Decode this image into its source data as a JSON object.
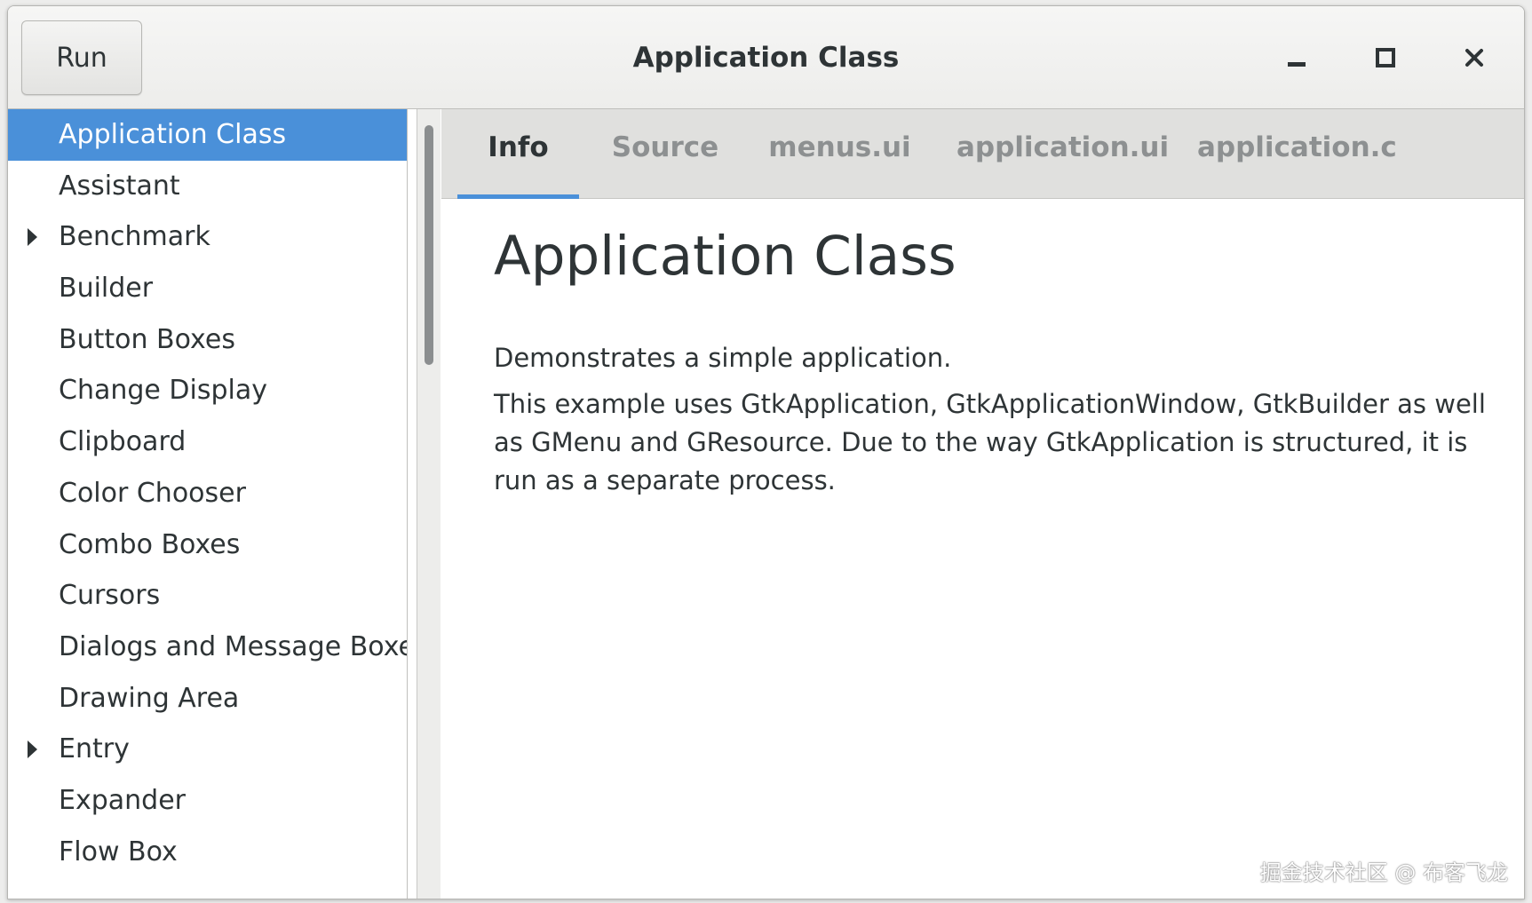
{
  "window": {
    "title": "Application Class",
    "run_label": "Run",
    "controls": {
      "minimize_icon": "minimize-icon",
      "maximize_icon": "maximize-icon",
      "close_icon": "close-icon",
      "close_glyph": "✕"
    }
  },
  "sidebar": {
    "items": [
      {
        "label": "Application Class",
        "selected": true,
        "expandable": false
      },
      {
        "label": "Assistant",
        "selected": false,
        "expandable": false
      },
      {
        "label": "Benchmark",
        "selected": false,
        "expandable": true
      },
      {
        "label": "Builder",
        "selected": false,
        "expandable": false
      },
      {
        "label": "Button Boxes",
        "selected": false,
        "expandable": false
      },
      {
        "label": "Change Display",
        "selected": false,
        "expandable": false
      },
      {
        "label": "Clipboard",
        "selected": false,
        "expandable": false
      },
      {
        "label": "Color Chooser",
        "selected": false,
        "expandable": false
      },
      {
        "label": "Combo Boxes",
        "selected": false,
        "expandable": false
      },
      {
        "label": "Cursors",
        "selected": false,
        "expandable": false
      },
      {
        "label": "Dialogs and Message Boxes",
        "selected": false,
        "expandable": false
      },
      {
        "label": "Drawing Area",
        "selected": false,
        "expandable": false
      },
      {
        "label": "Entry",
        "selected": false,
        "expandable": true
      },
      {
        "label": "Expander",
        "selected": false,
        "expandable": false
      },
      {
        "label": "Flow Box",
        "selected": false,
        "expandable": false
      }
    ]
  },
  "tabs": [
    {
      "label": "Info",
      "active": true
    },
    {
      "label": "Source",
      "active": false
    },
    {
      "label": "menus.ui",
      "active": false
    },
    {
      "label": "application.ui",
      "active": false
    },
    {
      "label": "application.c",
      "active": false
    }
  ],
  "content": {
    "heading": "Application Class",
    "paragraph1": "Demonstrates a simple application.",
    "paragraph2": "This example uses GtkApplication, GtkApplicationWindow, GtkBuilder as well as GMenu and GResource. Due to the way GtkApplication is structured, it is run as a separate process."
  },
  "watermark": "掘金技术社区 @ 布客飞龙",
  "colors": {
    "accent": "#4a90d9",
    "text": "#2e3436",
    "inactive_tab": "#8d9091",
    "tabbar_bg": "#e0e0de"
  }
}
